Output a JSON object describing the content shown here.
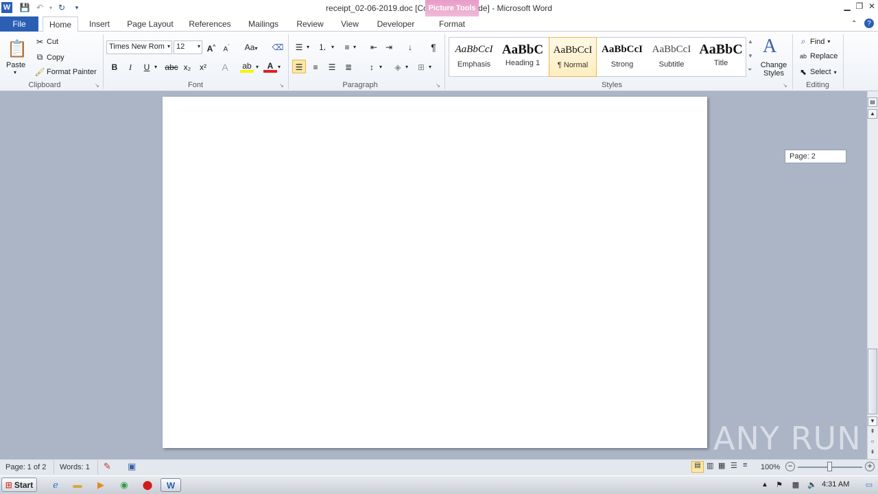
{
  "window": {
    "title": "receipt_02-06-2019.doc [Compatibility Mode]  -  Microsoft Word",
    "contextual_tab_group": "Picture Tools"
  },
  "tabs": {
    "file": "File",
    "items": [
      "Home",
      "Insert",
      "Page Layout",
      "References",
      "Mailings",
      "Review",
      "View",
      "Developer",
      "Format"
    ]
  },
  "clipboard": {
    "paste": "Paste",
    "cut": "Cut",
    "copy": "Copy",
    "format_painter": "Format Painter",
    "label": "Clipboard"
  },
  "font": {
    "font_name": "Times New Rom",
    "font_size": "12",
    "label": "Font",
    "bold": "B",
    "italic": "I",
    "underline": "U",
    "strike": "abc",
    "subscript": "x₂",
    "superscript": "x²",
    "change_case": "Aa"
  },
  "paragraph": {
    "label": "Paragraph",
    "pilcrow": "¶"
  },
  "styles": {
    "label": "Styles",
    "items": [
      {
        "preview": "AaBbCcI",
        "name": "Emphasis"
      },
      {
        "preview": "AaBbC",
        "name": "Heading 1"
      },
      {
        "preview": "AaBbCcI",
        "name": "¶ Normal"
      },
      {
        "preview": "AaBbCcI",
        "name": "Strong"
      },
      {
        "preview": "AaBbCcI",
        "name": "Subtitle"
      },
      {
        "preview": "AaBbC",
        "name": "Title"
      }
    ],
    "change_styles": "Change Styles"
  },
  "editing": {
    "label": "Editing",
    "find": "Find",
    "replace": "Replace",
    "select": "Select"
  },
  "document": {
    "page_tooltip": "Page: 2"
  },
  "status": {
    "page": "Page: 1 of 2",
    "words": "Words: 1",
    "zoom": "100%"
  },
  "taskbar": {
    "start": "Start",
    "clock": "4:31 AM"
  },
  "watermark": "ANY RUN",
  "colors": {
    "file_tab": "#2b5fb4",
    "picture_tools": "#e89bc6",
    "doc_background": "#abb5c6"
  }
}
